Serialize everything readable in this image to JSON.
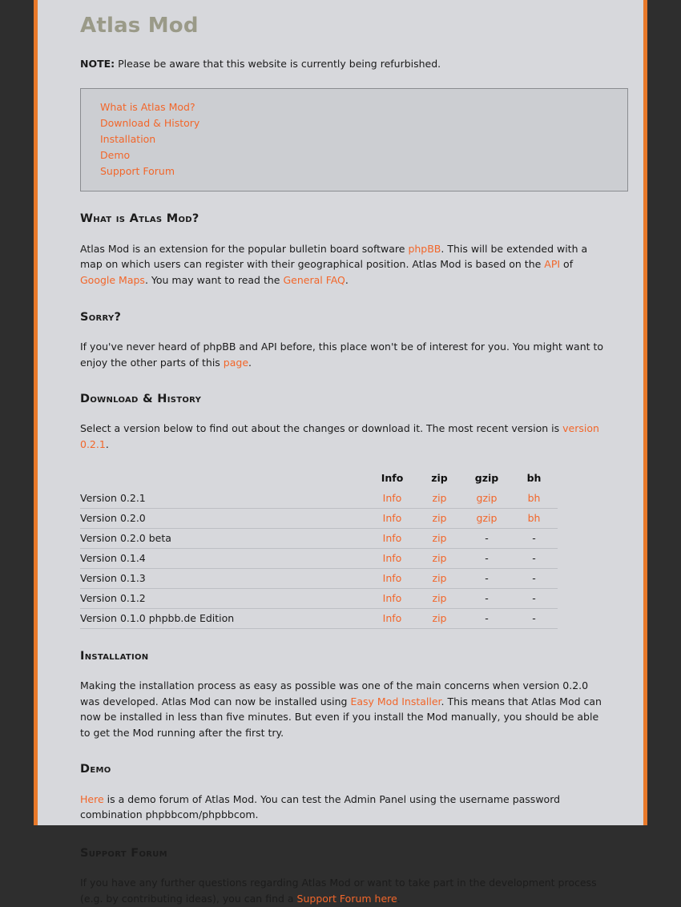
{
  "theme": {
    "page_bg": "#d7d8dc",
    "outer_bg": "#2e2e2e",
    "accent": "#f2662a",
    "title_color": "#9a9a88",
    "navbox_bg": "#ccced2",
    "navbox_border": "#8a8c90",
    "rule_color": "#bdbfc4"
  },
  "header": {
    "title": "Atlas Mod"
  },
  "note": {
    "label": "NOTE:",
    "text": " Please be aware that this website is currently being refurbished."
  },
  "nav": {
    "items": [
      {
        "label": "What is Atlas Mod?"
      },
      {
        "label": "Download & History"
      },
      {
        "label": "Installation"
      },
      {
        "label": "Demo"
      },
      {
        "label": "Support Forum"
      }
    ]
  },
  "sections": {
    "what": {
      "heading": "What is Atlas Mod?",
      "p1_a": "Atlas Mod is an extension for the popular bulletin board software ",
      "link_phpbb": "phpBB",
      "p1_b": ". This will be extended with a map on which users can register with their geographical position. Atlas Mod is based on the ",
      "link_api": "API",
      "p1_c": " of ",
      "link_gmaps": "Google Maps",
      "p1_d": ". You may want to read the ",
      "link_faq": "General FAQ",
      "p1_e": "."
    },
    "sorry": {
      "heading": "Sorry?",
      "p1_a": "If you've never heard of phpBB and API before, this place won't be of interest for you. You might want to enjoy the other parts of this ",
      "link_page": "page",
      "p1_b": "."
    },
    "download": {
      "heading": "Download & History",
      "p1_a": "Select a version below to find out about the changes or download it. The most recent version is ",
      "link_version": "version 0.2.1",
      "p1_b": "."
    },
    "installation": {
      "heading": "Installation",
      "p1_a": "Making the installation process as easy as possible was one of the main concerns when version 0.2.0 was developed. Atlas Mod can now be installed using ",
      "link_emi": "Easy Mod Installer",
      "p1_b": ". This means that Atlas Mod can now be installed in less than five minutes. But even if you install the Mod manually, you should be able to get the Mod running after the first try."
    },
    "demo": {
      "heading": "Demo",
      "link_here": "Here",
      "p1_a": " is a demo forum of Atlas Mod. You can test the Admin Panel using the username password combination phpbbcom/phpbbcom."
    },
    "support": {
      "heading": "Support Forum",
      "p1_a": "If you have any further questions regarding Atlas Mod or want to take part in the development process (e.g. by contributing ideas), you can find a ",
      "link_forum": "Support Forum here",
      "p1_b": "."
    }
  },
  "download_table": {
    "columns": [
      "",
      "Info",
      "zip",
      "gzip",
      "bh"
    ],
    "rows": [
      {
        "version": "Version 0.2.1",
        "info": "Info",
        "zip": "zip",
        "gzip": "gzip",
        "bh": "bh",
        "gzip_link": true,
        "bh_link": true
      },
      {
        "version": "Version 0.2.0",
        "info": "Info",
        "zip": "zip",
        "gzip": "gzip",
        "bh": "bh",
        "gzip_link": true,
        "bh_link": true
      },
      {
        "version": "Version 0.2.0 beta",
        "info": "Info",
        "zip": "zip",
        "gzip": "-",
        "bh": "-",
        "gzip_link": false,
        "bh_link": false
      },
      {
        "version": "Version 0.1.4",
        "info": "Info",
        "zip": "zip",
        "gzip": "-",
        "bh": "-",
        "gzip_link": false,
        "bh_link": false
      },
      {
        "version": "Version 0.1.3",
        "info": "Info",
        "zip": "zip",
        "gzip": "-",
        "bh": "-",
        "gzip_link": false,
        "bh_link": false
      },
      {
        "version": "Version 0.1.2",
        "info": "Info",
        "zip": "zip",
        "gzip": "-",
        "bh": "-",
        "gzip_link": false,
        "bh_link": false
      },
      {
        "version": "Version 0.1.0 phpbb.de Edition",
        "info": "Info",
        "zip": "zip",
        "gzip": "-",
        "bh": "-",
        "gzip_link": false,
        "bh_link": false
      }
    ]
  }
}
